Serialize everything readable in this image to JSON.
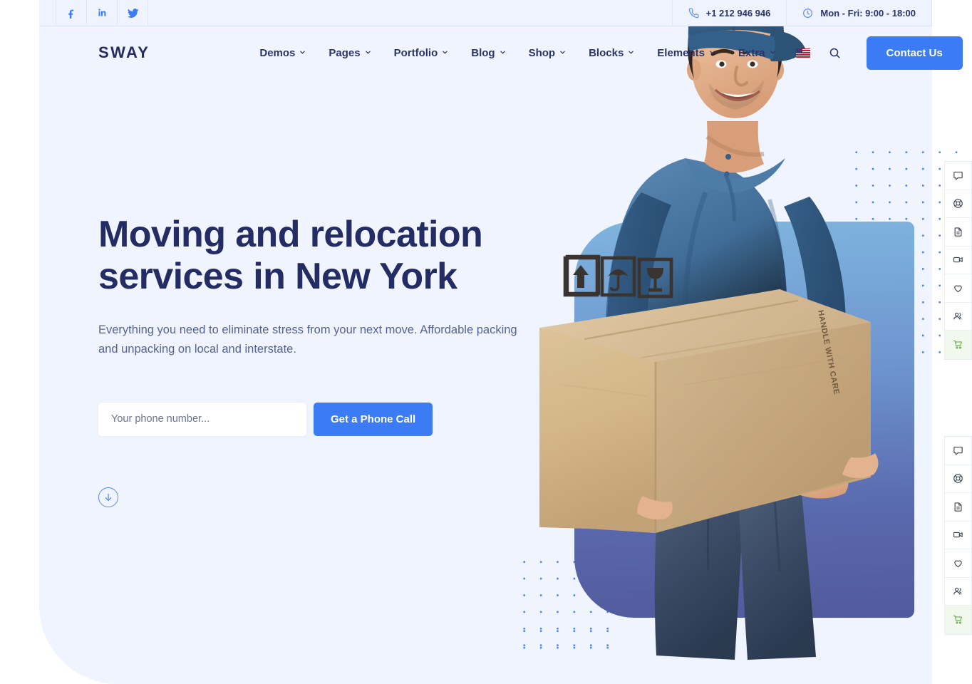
{
  "topbar": {
    "social": [
      {
        "name": "facebook",
        "label": "f"
      },
      {
        "name": "linkedin",
        "label": "in"
      },
      {
        "name": "twitter",
        "label": ""
      }
    ],
    "phone": "+1 212 946 946",
    "hours": "Mon - Fri: 9:00 - 18:00",
    "phone_icon": "phone-icon",
    "clock_icon": "clock-icon"
  },
  "nav": {
    "logo": "SWAY",
    "items": [
      {
        "label": "Demos",
        "has_dropdown": true
      },
      {
        "label": "Pages",
        "has_dropdown": true
      },
      {
        "label": "Portfolio",
        "has_dropdown": true
      },
      {
        "label": "Blog",
        "has_dropdown": true
      },
      {
        "label": "Shop",
        "has_dropdown": true
      },
      {
        "label": "Blocks",
        "has_dropdown": true
      },
      {
        "label": "Elements",
        "has_dropdown": true
      },
      {
        "label": "Extra",
        "has_dropdown": true
      }
    ],
    "language_icon": "us-flag-icon",
    "search_icon": "search-icon",
    "cta_label": "Contact Us",
    "cta_color": "#3b7cf5"
  },
  "hero": {
    "title": "Moving and relocation services in New York",
    "subtitle": "Everything you need to eliminate stress from your next move. Affordable packing and unpacking on local and interstate.",
    "title_color": "#232c63",
    "subtitle_color": "#566296",
    "background_color": "#f0f4fe",
    "form": {
      "placeholder": "Your phone number...",
      "value": "",
      "submit_label": "Get a Phone Call"
    },
    "scroll_icon": "arrow-down-circle-icon",
    "image": {
      "alt": "Delivery man in blue cap and polo shirt holding a cardboard box",
      "card_gradient_top": "#7fb4de",
      "card_gradient_bottom": "#515a9c",
      "box_labels": [
        "HANDLE WITH CARE"
      ],
      "box_symbols": [
        "this-way-up-icon",
        "keep-dry-umbrella-icon",
        "fragile-glass-icon"
      ]
    },
    "decor": {
      "dot_color": "#3b7cf5",
      "dot_pattern_name": "dotted-grid-pattern"
    }
  },
  "side_rails": [
    {
      "name": "side-rail-top",
      "items": [
        {
          "icon": "chat-bubble-icon",
          "active": false
        },
        {
          "icon": "lifebuoy-icon",
          "active": false
        },
        {
          "icon": "document-icon",
          "active": false
        },
        {
          "icon": "video-camera-icon",
          "active": false
        },
        {
          "icon": "heart-icon",
          "active": false
        },
        {
          "icon": "users-icon",
          "active": false
        },
        {
          "icon": "shopping-cart-icon",
          "active": true
        }
      ]
    },
    {
      "name": "side-rail-bottom",
      "items": [
        {
          "icon": "chat-bubble-icon",
          "active": false
        },
        {
          "icon": "lifebuoy-icon",
          "active": false
        },
        {
          "icon": "document-icon",
          "active": false
        },
        {
          "icon": "video-camera-icon",
          "active": false
        },
        {
          "icon": "heart-icon",
          "active": false
        },
        {
          "icon": "users-icon",
          "active": false
        },
        {
          "icon": "shopping-cart-icon",
          "active": true
        }
      ]
    }
  ],
  "accent_colors": {
    "brand_blue": "#3b7cf5",
    "navy": "#232c63",
    "page_bg": "#f0f4fe",
    "topbar_bg": "#eef3fd",
    "cart_green": "#6aa84f"
  }
}
